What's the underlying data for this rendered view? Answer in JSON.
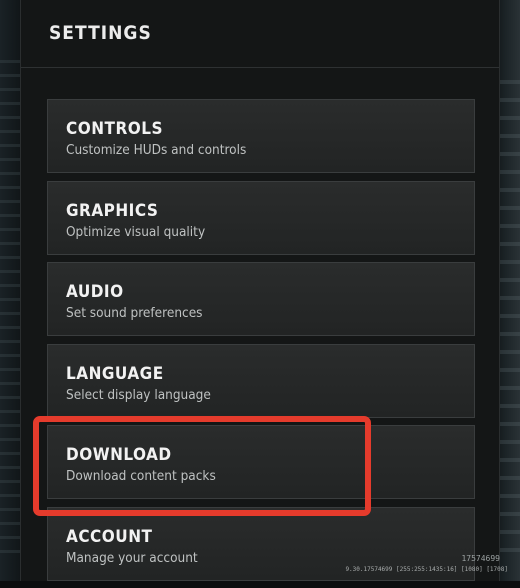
{
  "header": {
    "title": "SETTINGS"
  },
  "menu": {
    "items": [
      {
        "label": "CONTROLS",
        "description": "Customize HUDs and controls"
      },
      {
        "label": "GRAPHICS",
        "description": "Optimize visual quality"
      },
      {
        "label": "AUDIO",
        "description": "Set sound preferences"
      },
      {
        "label": "LANGUAGE",
        "description": "Select display language"
      },
      {
        "label": "DOWNLOAD",
        "description": "Download content packs"
      },
      {
        "label": "ACCOUNT",
        "description": "Manage your account"
      }
    ]
  },
  "footer": {
    "build_id": "17574699",
    "version_info": "9.30.17574699 [255:255:1435:16] [1080] [1708]"
  },
  "colors": {
    "highlight": "#e53b2c",
    "panel_background": "#141616",
    "tile_background": "#2a2c2c"
  }
}
